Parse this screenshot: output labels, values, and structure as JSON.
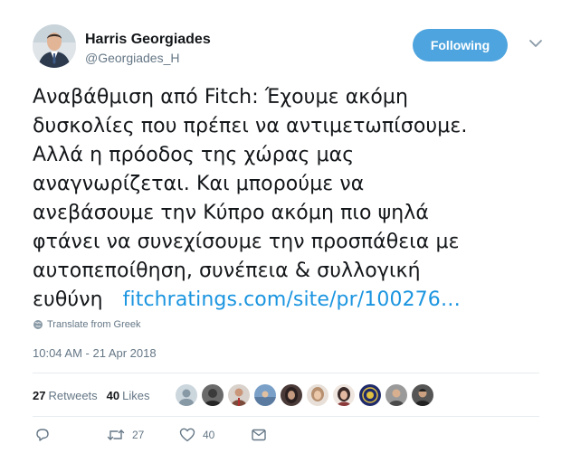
{
  "author": {
    "name": "Harris Georgiades",
    "handle": "@Georgiades_H",
    "avatar_icon": "profile-photo"
  },
  "follow_button": {
    "label": "Following",
    "color": "#4ea4de"
  },
  "menu": {
    "icon": "chevron-down-icon"
  },
  "tweet": {
    "text": "Αναβάθμιση από Fitch: Έχουμε ακόμη\nδυσκολίες που πρέπει να αντιμετωπίσουμε.\nΑλλά η πρόοδος της χώρας μας\nαναγνωρίζεται. Και μπορούμε να\nανεβάσουμε την Κύπρο ακόμη πιο ψηλά\nφτάνει να συνεχίσουμε την προσπάθεια με\nαυτοπεποίθηση, συνέπεια & συλλογική\nευθύνη",
    "link": "fitchratings.com/site/pr/100276…",
    "link_color": "#1b95e0"
  },
  "translate": {
    "label": "Translate from Greek",
    "icon": "globe-icon"
  },
  "timestamp": "10:04 AM - 21 Apr 2018",
  "stats": {
    "retweets_count": "27",
    "retweets_label": "Retweets",
    "likes_count": "40",
    "likes_label": "Likes"
  },
  "likers": [
    {
      "icon": "default-avatar-icon",
      "color": "#b8c4cc"
    },
    {
      "icon": "user-avatar-icon",
      "color": "#3b3b3b"
    },
    {
      "icon": "user-avatar-icon",
      "color": "#7a4a3a"
    },
    {
      "icon": "user-avatar-icon",
      "color": "#5a7aa0"
    },
    {
      "icon": "user-avatar-icon",
      "color": "#2b2020"
    },
    {
      "icon": "user-avatar-icon",
      "color": "#b79070"
    },
    {
      "icon": "user-avatar-icon",
      "color": "#8a3a3a"
    },
    {
      "icon": "user-avatar-icon",
      "color": "#1f2a6a"
    },
    {
      "icon": "user-avatar-icon",
      "color": "#4a4a4a"
    },
    {
      "icon": "user-avatar-icon",
      "color": "#222222"
    }
  ],
  "actions": {
    "reply_icon": "reply-icon",
    "retweet_icon": "retweet-icon",
    "retweet_count": "27",
    "like_icon": "heart-icon",
    "like_count": "40",
    "message_icon": "envelope-icon"
  },
  "colors": {
    "secondary_text": "#657786",
    "divider": "#e6ecf0"
  }
}
